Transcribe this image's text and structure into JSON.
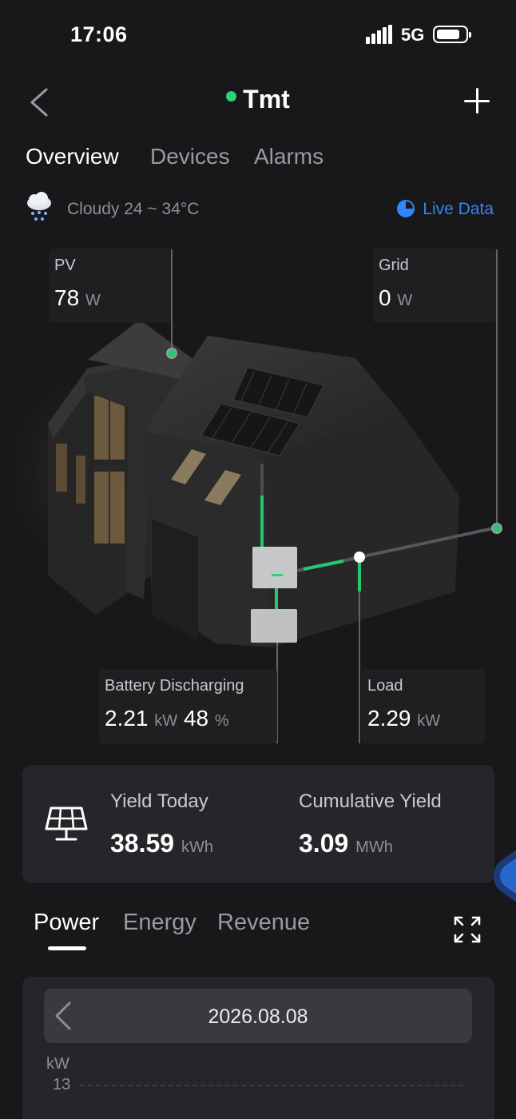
{
  "status_bar": {
    "time": "17:06",
    "network": "5G"
  },
  "header": {
    "title": "Tmt",
    "status_color": "#2fd07a"
  },
  "tabs": [
    {
      "label": "Overview",
      "active": true
    },
    {
      "label": "Devices",
      "active": false
    },
    {
      "label": "Alarms",
      "active": false
    }
  ],
  "weather": {
    "condition": "Cloudy",
    "range": "24 ~ 34°C",
    "icon": "cloud-rain-icon"
  },
  "live_data": {
    "label": "Live Data",
    "color": "#2f86ff"
  },
  "energy_flow": {
    "pv": {
      "label": "PV",
      "value": "78",
      "unit": "W"
    },
    "grid": {
      "label": "Grid",
      "value": "0",
      "unit": "W"
    },
    "battery": {
      "label": "Battery Discharging",
      "value": "2.21",
      "unit": "kW",
      "soc": "48",
      "soc_unit": "%"
    },
    "load": {
      "label": "Load",
      "value": "2.29",
      "unit": "kW"
    },
    "flow_color": "#27c76f"
  },
  "yield": {
    "today": {
      "label": "Yield Today",
      "value": "38.59",
      "unit": "kWh"
    },
    "cumulative": {
      "label": "Cumulative Yield",
      "value": "3.09",
      "unit": "MWh"
    }
  },
  "chart_tabs": [
    {
      "label": "Power",
      "active": true
    },
    {
      "label": "Energy",
      "active": false
    },
    {
      "label": "Revenue",
      "active": false
    }
  ],
  "chart": {
    "date": "2026.08.08",
    "unit": "kW",
    "y_tick_top": "13"
  }
}
